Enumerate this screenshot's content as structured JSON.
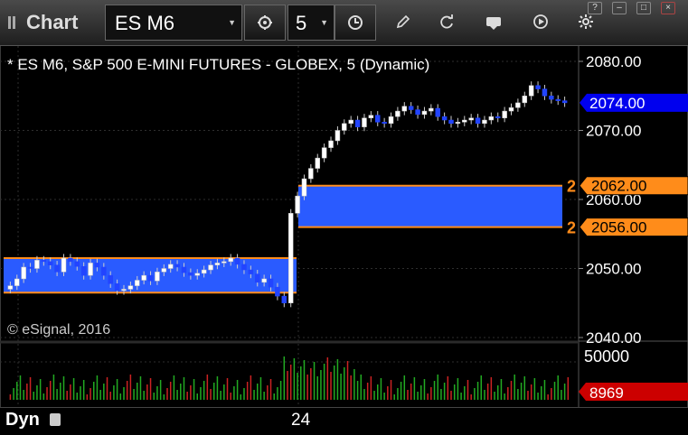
{
  "window": {
    "title": "Chart"
  },
  "toolbar": {
    "symbol": "ES M6",
    "interval": "5",
    "icons": [
      "link-icon",
      "clock-icon",
      "pencil-icon",
      "refresh-icon",
      "get-icon",
      "play-icon",
      "settings-icon"
    ]
  },
  "window_controls": [
    "?",
    "–",
    "□",
    "×"
  ],
  "chart": {
    "header": "* ES M6, S&P 500 E-MINI FUTURES - GLOBEX, 5 (Dynamic)",
    "copyright": "© eSignal, 2016",
    "price_ticks": [
      "2080.00",
      "2070.00",
      "2060.00",
      "2050.00",
      "2040.00"
    ],
    "last_price_label": "2074.00",
    "zone_high_label": "2062.00",
    "zone_low_label": "2056.00",
    "zone_count": "2",
    "volume_tick": "50000",
    "last_volume_label": "8969",
    "x_tick": "24",
    "colors": {
      "zone": "#2a5bff",
      "zone_border": "#ff8c1a",
      "last_price": "#0000ee",
      "volume_last": "#cc0000",
      "up": "#ffffff",
      "down": "#2244ff"
    }
  },
  "footer": {
    "mode": "Dyn"
  },
  "chart_data": {
    "type": "candlestick",
    "ylim": [
      2040,
      2082
    ],
    "price_points": [
      2047.5,
      2048.5,
      2050.2,
      2050.0,
      2051.2,
      2051.0,
      2050.5,
      2049.5,
      2051.5,
      2051.0,
      2050.3,
      2049.0,
      2050.8,
      2050.2,
      2049.0,
      2047.8,
      2046.8,
      2047.0,
      2047.5,
      2048.3,
      2049.0,
      2048.2,
      2049.5,
      2050.0,
      2050.6,
      2050.2,
      2049.4,
      2049.0,
      2049.3,
      2049.8,
      2050.5,
      2050.8,
      2051.0,
      2051.5,
      2050.6,
      2049.8,
      2049.2,
      2048.0,
      2048.5,
      2047.3,
      2046.0,
      2045.0,
      2058.0,
      2060.5,
      2063.0,
      2064.5,
      2066.0,
      2067.5,
      2068.5,
      2070.0,
      2071.0,
      2071.5,
      2070.5,
      2071.8,
      2072.2,
      2071.2,
      2071.0,
      2072.0,
      2072.8,
      2073.5,
      2073.0,
      2072.3,
      2072.8,
      2073.2,
      2072.0,
      2071.5,
      2071.0,
      2071.2,
      2071.5,
      2071.8,
      2071.0,
      2071.5,
      2072.0,
      2071.8,
      2072.8,
      2073.3,
      2074.0,
      2075.0,
      2076.5,
      2076.0,
      2075.0,
      2074.5,
      2074.3,
      2074.0
    ],
    "last_price": 2074.0,
    "zones": [
      {
        "high": 2051.5,
        "low": 2046.5
      },
      {
        "high": 2062.0,
        "low": 2056.0
      }
    ],
    "volume_last": 8969,
    "volume_tick": 50000
  }
}
